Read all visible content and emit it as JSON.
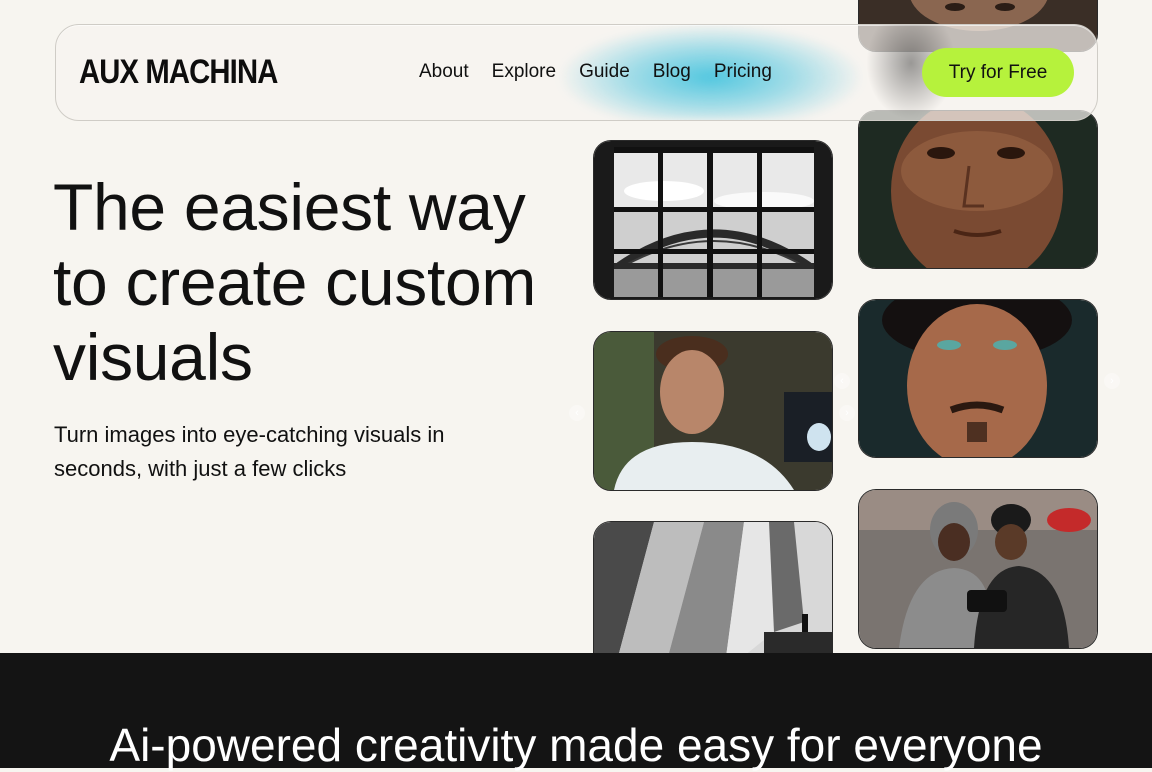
{
  "brand": {
    "logo": "AUX MACHINA"
  },
  "nav": {
    "items": [
      "About",
      "Explore",
      "Guide",
      "Blog",
      "Pricing"
    ],
    "cta_label": "Try for Free"
  },
  "hero": {
    "headline": "The easiest way to create custom visuals",
    "subheadline": "Turn images into eye-catching visuals in seconds, with just a few clicks"
  },
  "gallery": {
    "images": [
      "man-portrait-top",
      "window-bridge-photo",
      "older-man-portrait",
      "man-at-desk-photo",
      "freckled-man-portrait",
      "people-with-camera-photo",
      "architecture-photo"
    ]
  },
  "section": {
    "title": "Ai-powered creativity made easy for everyone"
  },
  "colors": {
    "accent": "#b6f23c",
    "background": "#f7f5f0",
    "dark_band": "#141414",
    "glow": "#48c4de"
  }
}
